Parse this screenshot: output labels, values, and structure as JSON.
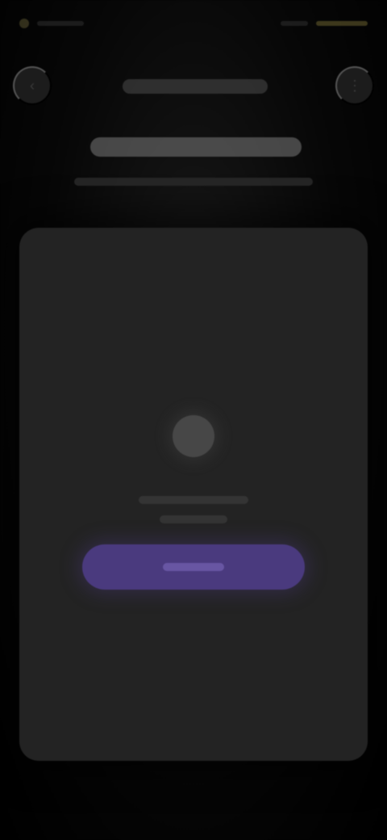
{
  "screen": {
    "state": "blurred"
  },
  "colors": {
    "background": "#000000",
    "card": "#232323",
    "accent_button": "#4a3a7e",
    "status_accent": "#6b6230"
  },
  "header": {
    "back_icon": "back-icon",
    "menu_icon": "menu-icon"
  },
  "main": {
    "empty_icon": "empty-state-icon"
  }
}
